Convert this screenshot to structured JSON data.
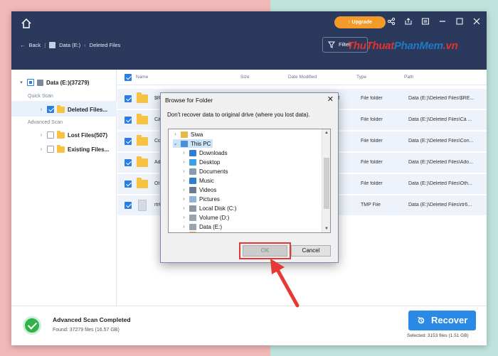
{
  "app": {
    "upgrade_label": "Upgrade",
    "nav": {
      "back": "Back",
      "drive": "Data (E:)",
      "folder": "Deleted Files"
    },
    "filter_label": "Filter",
    "watermark": {
      "part1": "ThuThuat",
      "part2": "PhanMem",
      "part3": ".vn"
    }
  },
  "sidebar": {
    "root_label": "Data (E:)(37279)",
    "quick_scan_label": "Quick Scan",
    "deleted_files_label": "Deleted Files...",
    "advanced_scan_label": "Advanced Scan",
    "lost_files_label": "Lost Files(507)",
    "existing_files_label": "Existing Files..."
  },
  "table": {
    "headers": {
      "name": "Name",
      "size": "Size",
      "date": "Date Modified",
      "type": "Type",
      "path": "Path"
    },
    "rows": [
      {
        "name": "$RECYCLE.BIN",
        "date": "9/22/2020 9:44:51 AM",
        "type": "File folder",
        "path": "Data (E:)\\Deleted Files\\$RE...",
        "icon": "folder-icon"
      },
      {
        "name": "Cà",
        "date": "AM",
        "type": "File folder",
        "path": "Data (E:)\\Deleted Files\\Cà ...",
        "icon": "folder-icon"
      },
      {
        "name": "Co",
        "date": "AM",
        "type": "File folder",
        "path": "Data (E:)\\Deleted Files\\Con...",
        "icon": "folder-icon"
      },
      {
        "name": "Ad",
        "date": "AM",
        "type": "File folder",
        "path": "Data (E:)\\Deleted Files\\Ado...",
        "icon": "folder-icon"
      },
      {
        "name": "Ot",
        "date": "AM",
        "type": "File folder",
        "path": "Data (E:)\\Deleted Files\\Oth...",
        "icon": "folder-icon"
      },
      {
        "name": "rtr6",
        "date": "AM",
        "type": "TMP File",
        "path": "Data (E:)\\Deleted Files\\rtr6...",
        "icon": "file-icon"
      }
    ]
  },
  "bottom": {
    "scan_title": "Advanced Scan Completed",
    "found_text": "Found: 37279 files (16.57 GB)",
    "recover_label": "Recover",
    "selected_text": "Selected: 3153 files (1.51 GB)"
  },
  "dialog": {
    "title": "Browse for Folder",
    "message": "Don't recover data to original drive (where you lost data).",
    "tree": [
      {
        "label": "Siwa",
        "icon": "user-folder-icon",
        "color": "#e8b84a"
      },
      {
        "label": "This PC",
        "icon": "computer-icon",
        "color": "#4a90d9",
        "selected": true
      },
      {
        "label": "Downloads",
        "icon": "download-arrow-icon",
        "color": "#2f7fd1"
      },
      {
        "label": "Desktop",
        "icon": "desktop-icon",
        "color": "#3aa0e8"
      },
      {
        "label": "Documents",
        "icon": "documents-icon",
        "color": "#8a9bb3"
      },
      {
        "label": "Music",
        "icon": "music-note-icon",
        "color": "#2f7fd1"
      },
      {
        "label": "Videos",
        "icon": "videos-icon",
        "color": "#6b7a8f"
      },
      {
        "label": "Pictures",
        "icon": "pictures-icon",
        "color": "#8fb6d9"
      },
      {
        "label": "Local Disk (C:)",
        "icon": "system-drive-icon",
        "color": "#8c98a8"
      },
      {
        "label": "Volume (D:)",
        "icon": "drive-icon",
        "color": "#9aa3ae"
      },
      {
        "label": "Data (E:)",
        "icon": "drive-icon",
        "color": "#9aa3ae"
      },
      {
        "label": "Dama",
        "icon": "folder-icon",
        "color": "#e8b84a"
      }
    ],
    "ok_label": "OK",
    "cancel_label": "Cancel"
  },
  "colors": {
    "accent": "#2a8ae6",
    "titlebar": "#2b3a5c",
    "upgrade": "#f39a2a",
    "success": "#32b34a",
    "highlight": "#e53935"
  }
}
